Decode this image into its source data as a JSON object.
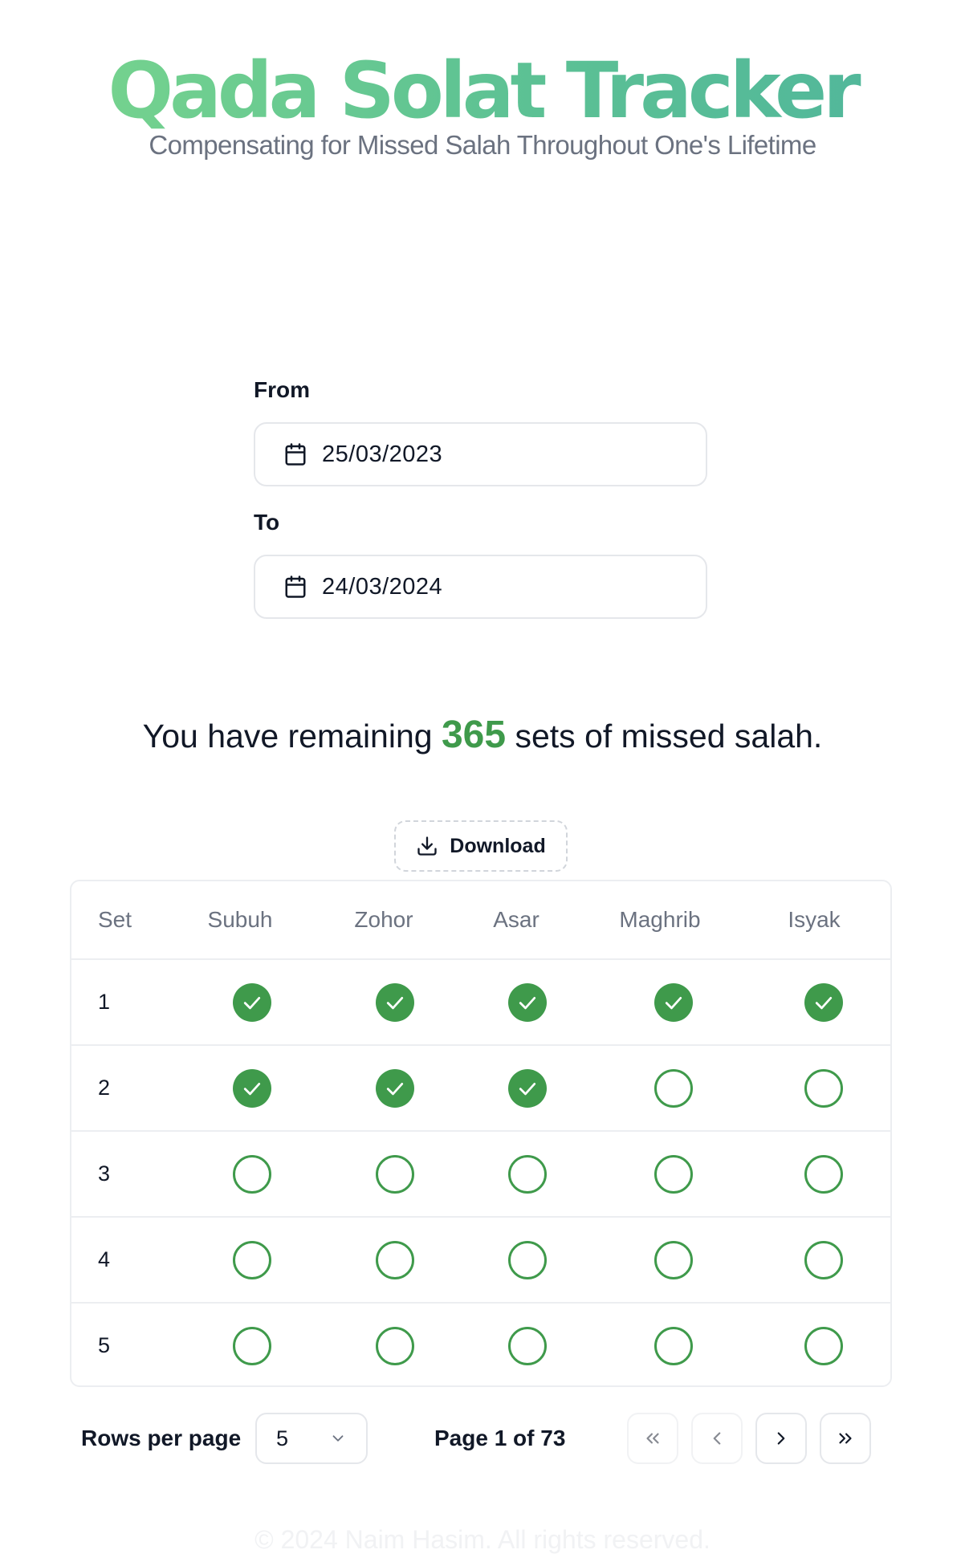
{
  "header": {
    "title": "Qada Solat Tracker",
    "subtitle": "Compensating for Missed Salah Throughout One's Lifetime"
  },
  "form": {
    "from_label": "From",
    "from_value": "25/03/2023",
    "to_label": "To",
    "to_value": "24/03/2024",
    "icon": "calendar-icon"
  },
  "summary": {
    "prefix": "You have remaining",
    "count": "365",
    "suffix": "sets of missed salah."
  },
  "download": {
    "label": "Download",
    "icon": "download-icon"
  },
  "table": {
    "columns": [
      "Set",
      "Subuh",
      "Zohor",
      "Asar",
      "Maghrib",
      "Isyak"
    ],
    "rows": [
      {
        "set": "1",
        "done": [
          true,
          true,
          true,
          true,
          true
        ]
      },
      {
        "set": "2",
        "done": [
          true,
          true,
          true,
          false,
          false
        ]
      },
      {
        "set": "3",
        "done": [
          false,
          false,
          false,
          false,
          false
        ]
      },
      {
        "set": "4",
        "done": [
          false,
          false,
          false,
          false,
          false
        ]
      },
      {
        "set": "5",
        "done": [
          false,
          false,
          false,
          false,
          false
        ]
      }
    ]
  },
  "pagination": {
    "rows_per_page_label": "Rows per page",
    "rows_per_page_value": "5",
    "page_info": "Page 1 of 73",
    "first_disabled": true,
    "prev_disabled": true
  },
  "footer": {
    "text": "© 2024 Naim Hasim. All rights reserved."
  },
  "colors": {
    "accent": "#3f9a4b",
    "gradient_start": "#7ad68d",
    "gradient_end": "#4fb59c",
    "muted": "#6b7280",
    "border": "#e5e7eb"
  }
}
